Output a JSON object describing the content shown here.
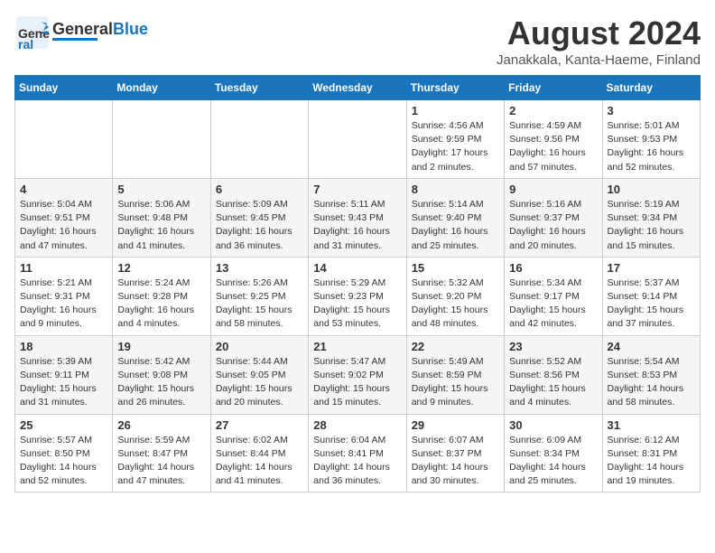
{
  "header": {
    "logo_general": "General",
    "logo_blue": "Blue",
    "month_title": "August 2024",
    "location": "Janakkala, Kanta-Haeme, Finland"
  },
  "days_of_week": [
    "Sunday",
    "Monday",
    "Tuesday",
    "Wednesday",
    "Thursday",
    "Friday",
    "Saturday"
  ],
  "weeks": [
    [
      {
        "day": "",
        "info": ""
      },
      {
        "day": "",
        "info": ""
      },
      {
        "day": "",
        "info": ""
      },
      {
        "day": "",
        "info": ""
      },
      {
        "day": "1",
        "info": "Sunrise: 4:56 AM\nSunset: 9:59 PM\nDaylight: 17 hours\nand 2 minutes."
      },
      {
        "day": "2",
        "info": "Sunrise: 4:59 AM\nSunset: 9:56 PM\nDaylight: 16 hours\nand 57 minutes."
      },
      {
        "day": "3",
        "info": "Sunrise: 5:01 AM\nSunset: 9:53 PM\nDaylight: 16 hours\nand 52 minutes."
      }
    ],
    [
      {
        "day": "4",
        "info": "Sunrise: 5:04 AM\nSunset: 9:51 PM\nDaylight: 16 hours\nand 47 minutes."
      },
      {
        "day": "5",
        "info": "Sunrise: 5:06 AM\nSunset: 9:48 PM\nDaylight: 16 hours\nand 41 minutes."
      },
      {
        "day": "6",
        "info": "Sunrise: 5:09 AM\nSunset: 9:45 PM\nDaylight: 16 hours\nand 36 minutes."
      },
      {
        "day": "7",
        "info": "Sunrise: 5:11 AM\nSunset: 9:43 PM\nDaylight: 16 hours\nand 31 minutes."
      },
      {
        "day": "8",
        "info": "Sunrise: 5:14 AM\nSunset: 9:40 PM\nDaylight: 16 hours\nand 25 minutes."
      },
      {
        "day": "9",
        "info": "Sunrise: 5:16 AM\nSunset: 9:37 PM\nDaylight: 16 hours\nand 20 minutes."
      },
      {
        "day": "10",
        "info": "Sunrise: 5:19 AM\nSunset: 9:34 PM\nDaylight: 16 hours\nand 15 minutes."
      }
    ],
    [
      {
        "day": "11",
        "info": "Sunrise: 5:21 AM\nSunset: 9:31 PM\nDaylight: 16 hours\nand 9 minutes."
      },
      {
        "day": "12",
        "info": "Sunrise: 5:24 AM\nSunset: 9:28 PM\nDaylight: 16 hours\nand 4 minutes."
      },
      {
        "day": "13",
        "info": "Sunrise: 5:26 AM\nSunset: 9:25 PM\nDaylight: 15 hours\nand 58 minutes."
      },
      {
        "day": "14",
        "info": "Sunrise: 5:29 AM\nSunset: 9:23 PM\nDaylight: 15 hours\nand 53 minutes."
      },
      {
        "day": "15",
        "info": "Sunrise: 5:32 AM\nSunset: 9:20 PM\nDaylight: 15 hours\nand 48 minutes."
      },
      {
        "day": "16",
        "info": "Sunrise: 5:34 AM\nSunset: 9:17 PM\nDaylight: 15 hours\nand 42 minutes."
      },
      {
        "day": "17",
        "info": "Sunrise: 5:37 AM\nSunset: 9:14 PM\nDaylight: 15 hours\nand 37 minutes."
      }
    ],
    [
      {
        "day": "18",
        "info": "Sunrise: 5:39 AM\nSunset: 9:11 PM\nDaylight: 15 hours\nand 31 minutes."
      },
      {
        "day": "19",
        "info": "Sunrise: 5:42 AM\nSunset: 9:08 PM\nDaylight: 15 hours\nand 26 minutes."
      },
      {
        "day": "20",
        "info": "Sunrise: 5:44 AM\nSunset: 9:05 PM\nDaylight: 15 hours\nand 20 minutes."
      },
      {
        "day": "21",
        "info": "Sunrise: 5:47 AM\nSunset: 9:02 PM\nDaylight: 15 hours\nand 15 minutes."
      },
      {
        "day": "22",
        "info": "Sunrise: 5:49 AM\nSunset: 8:59 PM\nDaylight: 15 hours\nand 9 minutes."
      },
      {
        "day": "23",
        "info": "Sunrise: 5:52 AM\nSunset: 8:56 PM\nDaylight: 15 hours\nand 4 minutes."
      },
      {
        "day": "24",
        "info": "Sunrise: 5:54 AM\nSunset: 8:53 PM\nDaylight: 14 hours\nand 58 minutes."
      }
    ],
    [
      {
        "day": "25",
        "info": "Sunrise: 5:57 AM\nSunset: 8:50 PM\nDaylight: 14 hours\nand 52 minutes."
      },
      {
        "day": "26",
        "info": "Sunrise: 5:59 AM\nSunset: 8:47 PM\nDaylight: 14 hours\nand 47 minutes."
      },
      {
        "day": "27",
        "info": "Sunrise: 6:02 AM\nSunset: 8:44 PM\nDaylight: 14 hours\nand 41 minutes."
      },
      {
        "day": "28",
        "info": "Sunrise: 6:04 AM\nSunset: 8:41 PM\nDaylight: 14 hours\nand 36 minutes."
      },
      {
        "day": "29",
        "info": "Sunrise: 6:07 AM\nSunset: 8:37 PM\nDaylight: 14 hours\nand 30 minutes."
      },
      {
        "day": "30",
        "info": "Sunrise: 6:09 AM\nSunset: 8:34 PM\nDaylight: 14 hours\nand 25 minutes."
      },
      {
        "day": "31",
        "info": "Sunrise: 6:12 AM\nSunset: 8:31 PM\nDaylight: 14 hours\nand 19 minutes."
      }
    ]
  ]
}
